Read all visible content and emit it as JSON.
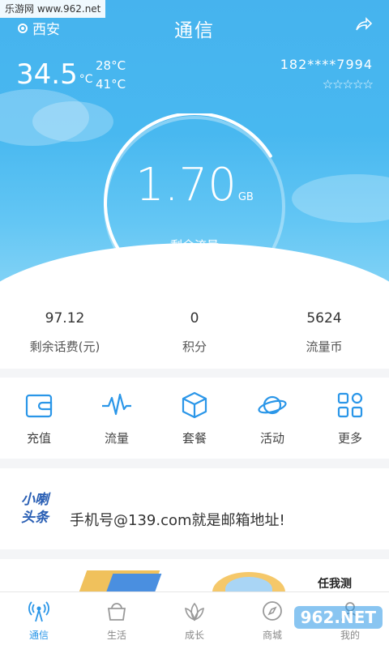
{
  "watermark_top": "乐游网 www.962.net",
  "header": {
    "location": "西安",
    "title": "通信"
  },
  "weather": {
    "current": "34.5",
    "unit": "°C",
    "high": "28°C",
    "low": "41°C"
  },
  "account": {
    "phone": "182****7994",
    "stars": "☆☆☆☆☆"
  },
  "gauge": {
    "value": "1.70",
    "unit": "GB",
    "label": "剩余流量",
    "fill_fraction": 0.72
  },
  "stats": [
    {
      "value": "97.12",
      "label": "剩余话费(元)"
    },
    {
      "value": "0",
      "label": "积分"
    },
    {
      "value": "5624",
      "label": "流量币"
    }
  ],
  "menu": [
    {
      "label": "充值",
      "icon": "wallet-icon"
    },
    {
      "label": "流量",
      "icon": "pulse-icon"
    },
    {
      "label": "套餐",
      "icon": "box-icon"
    },
    {
      "label": "活动",
      "icon": "planet-icon"
    },
    {
      "label": "更多",
      "icon": "grid-icon"
    }
  ],
  "news": {
    "logo_line1": "小喇",
    "logo_line2": "头条",
    "headline": "手机号@139.com就是邮箱地址!"
  },
  "banner": {
    "text": "任我测"
  },
  "tabs": [
    {
      "label": "通信",
      "icon": "signal-tower-icon",
      "active": true
    },
    {
      "label": "生活",
      "icon": "basket-icon",
      "active": false
    },
    {
      "label": "成长",
      "icon": "lotus-icon",
      "active": false
    },
    {
      "label": "商城",
      "icon": "compass-icon",
      "active": false
    },
    {
      "label": "我的",
      "icon": "person-icon",
      "active": false
    }
  ],
  "watermark_bottom": "962.NET",
  "colors": {
    "accent": "#2a96e8",
    "hero_top": "#46b3ee"
  }
}
